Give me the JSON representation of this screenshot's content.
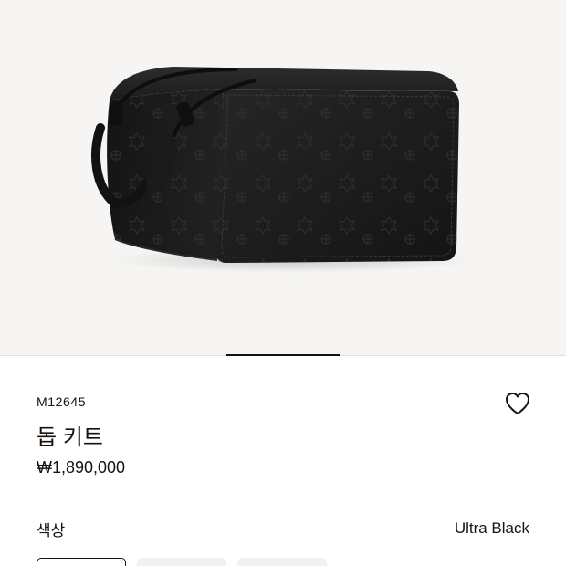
{
  "product": {
    "image_icon": "dopp-kit-product-image",
    "sku": "M12645",
    "name": "돕 키트",
    "price": "₩1,890,000",
    "wishlist_icon": "heart-outline-icon"
  },
  "gallery": {
    "active_slide": 1,
    "slide_count": 5
  },
  "color": {
    "label": "색상",
    "selected_value": "Ultra Black",
    "swatches": [
      {
        "name": "Ultra Black",
        "selected": true
      },
      {
        "name": "",
        "selected": false
      },
      {
        "name": "",
        "selected": false
      }
    ]
  },
  "colors": {
    "text": "#19110b",
    "gallery_bg": "#f6f5f3",
    "bag": "#1d1d1d"
  }
}
